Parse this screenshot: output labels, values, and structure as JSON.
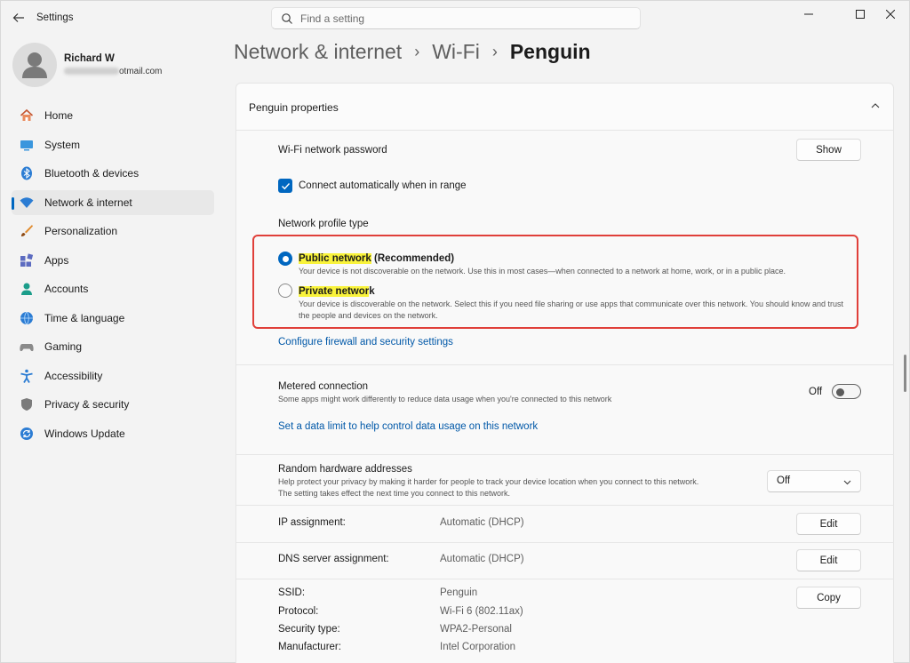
{
  "window": {
    "app_title": "Settings",
    "search_placeholder": "Find a setting"
  },
  "user": {
    "name": "Richard W",
    "email_visible": "otmail.com"
  },
  "sidebar": {
    "items": [
      {
        "label": "Home",
        "icon": "home-icon"
      },
      {
        "label": "System",
        "icon": "system-icon"
      },
      {
        "label": "Bluetooth & devices",
        "icon": "bluetooth-icon"
      },
      {
        "label": "Network & internet",
        "icon": "wifi-icon",
        "active": true
      },
      {
        "label": "Personalization",
        "icon": "brush-icon"
      },
      {
        "label": "Apps",
        "icon": "apps-icon"
      },
      {
        "label": "Accounts",
        "icon": "accounts-icon"
      },
      {
        "label": "Time & language",
        "icon": "globe-clock-icon"
      },
      {
        "label": "Gaming",
        "icon": "gamepad-icon"
      },
      {
        "label": "Accessibility",
        "icon": "accessibility-icon"
      },
      {
        "label": "Privacy & security",
        "icon": "shield-icon"
      },
      {
        "label": "Windows Update",
        "icon": "update-icon"
      }
    ]
  },
  "breadcrumb": {
    "part1": "Network & internet",
    "part2": "Wi-Fi",
    "current": "Penguin"
  },
  "properties": {
    "header": "Penguin properties",
    "password_label": "Wi-Fi network password",
    "show_button": "Show",
    "auto_connect_label": "Connect automatically when in range",
    "auto_connect_checked": true,
    "profile_type_label": "Network profile type",
    "public": {
      "title": "Public network",
      "suffix": " (Recommended)",
      "desc": "Your device is not discoverable on the network. Use this in most cases—when connected to a network at home, work, or in a public place.",
      "selected": true
    },
    "private": {
      "title": "Private networ",
      "title_tail": "k",
      "desc": "Your device is discoverable on the network. Select this if you need file sharing or use apps that communicate over this network. You should know and trust the people and devices on the network.",
      "selected": false
    },
    "firewall_link": "Configure firewall and security settings",
    "metered": {
      "label": "Metered connection",
      "desc": "Some apps might work differently to reduce data usage when you're connected to this network",
      "toggle_text": "Off",
      "toggle_on": false,
      "data_limit_link": "Set a data limit to help control data usage on this network"
    },
    "random_hw": {
      "label": "Random hardware addresses",
      "desc1": "Help protect your privacy by making it harder for people to track your device location when you connect to this network.",
      "desc2": "The setting takes effect the next time you connect to this network.",
      "select_value": "Off"
    },
    "ip": {
      "label": "IP assignment:",
      "value": "Automatic (DHCP)",
      "button": "Edit"
    },
    "dns": {
      "label": "DNS server assignment:",
      "value": "Automatic (DHCP)",
      "button": "Edit"
    },
    "copy_button": "Copy",
    "details": [
      {
        "label": "SSID:",
        "value": "Penguin"
      },
      {
        "label": "Protocol:",
        "value": "Wi-Fi 6 (802.11ax)"
      },
      {
        "label": "Security type:",
        "value": "WPA2-Personal"
      },
      {
        "label": "Manufacturer:",
        "value": "Intel Corporation"
      }
    ]
  },
  "colors": {
    "accent": "#0067c0",
    "link": "#0058a8",
    "highlight": "#f9f33b",
    "annotation_box": "#e0403a"
  }
}
